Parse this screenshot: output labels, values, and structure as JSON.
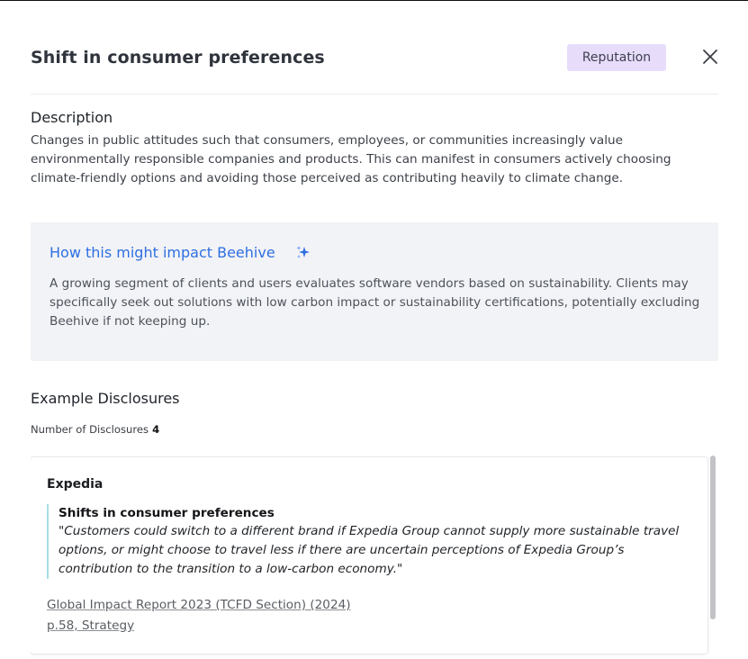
{
  "modal": {
    "title": "Shift in consumer preferences",
    "badge": "Reputation",
    "close_icon": "close-icon"
  },
  "description": {
    "heading": "Description",
    "text": "Changes in public attitudes such that consumers, employees, or communities increasingly value environmentally responsible companies and products. This can manifest in consumers actively choosing climate-friendly options and avoiding those perceived as contributing heavily to climate change."
  },
  "impact": {
    "heading": "How this might impact Beehive",
    "icon": "sparkle-icon",
    "text": "A growing segment of clients and users evaluates software vendors based on sustainability. Clients may specifically seek out solutions with low carbon impact or sustainability certifications, potentially excluding Beehive if not keeping up."
  },
  "examples": {
    "heading": "Example Disclosures",
    "count_label": "Number of Disclosures",
    "count": "4",
    "items": [
      {
        "company": "Expedia",
        "quote_title": "Shifts in consumer preferences",
        "quote": "\"Customers could switch to a different brand if Expedia Group cannot supply more sustainable travel options, or might choose to travel less if there are uncertain perceptions of Expedia Group’s contribution to the transition to a low-carbon economy.\"",
        "source": "Global Impact Report 2023 (TCFD Section) (2024)",
        "page": "p.58, Strategy"
      }
    ]
  },
  "colors": {
    "badge_bg": "#e7ddfb",
    "impact_bg": "#f2f3f6",
    "impact_title": "#2e6fe2",
    "quote_border": "#a9dde3"
  }
}
